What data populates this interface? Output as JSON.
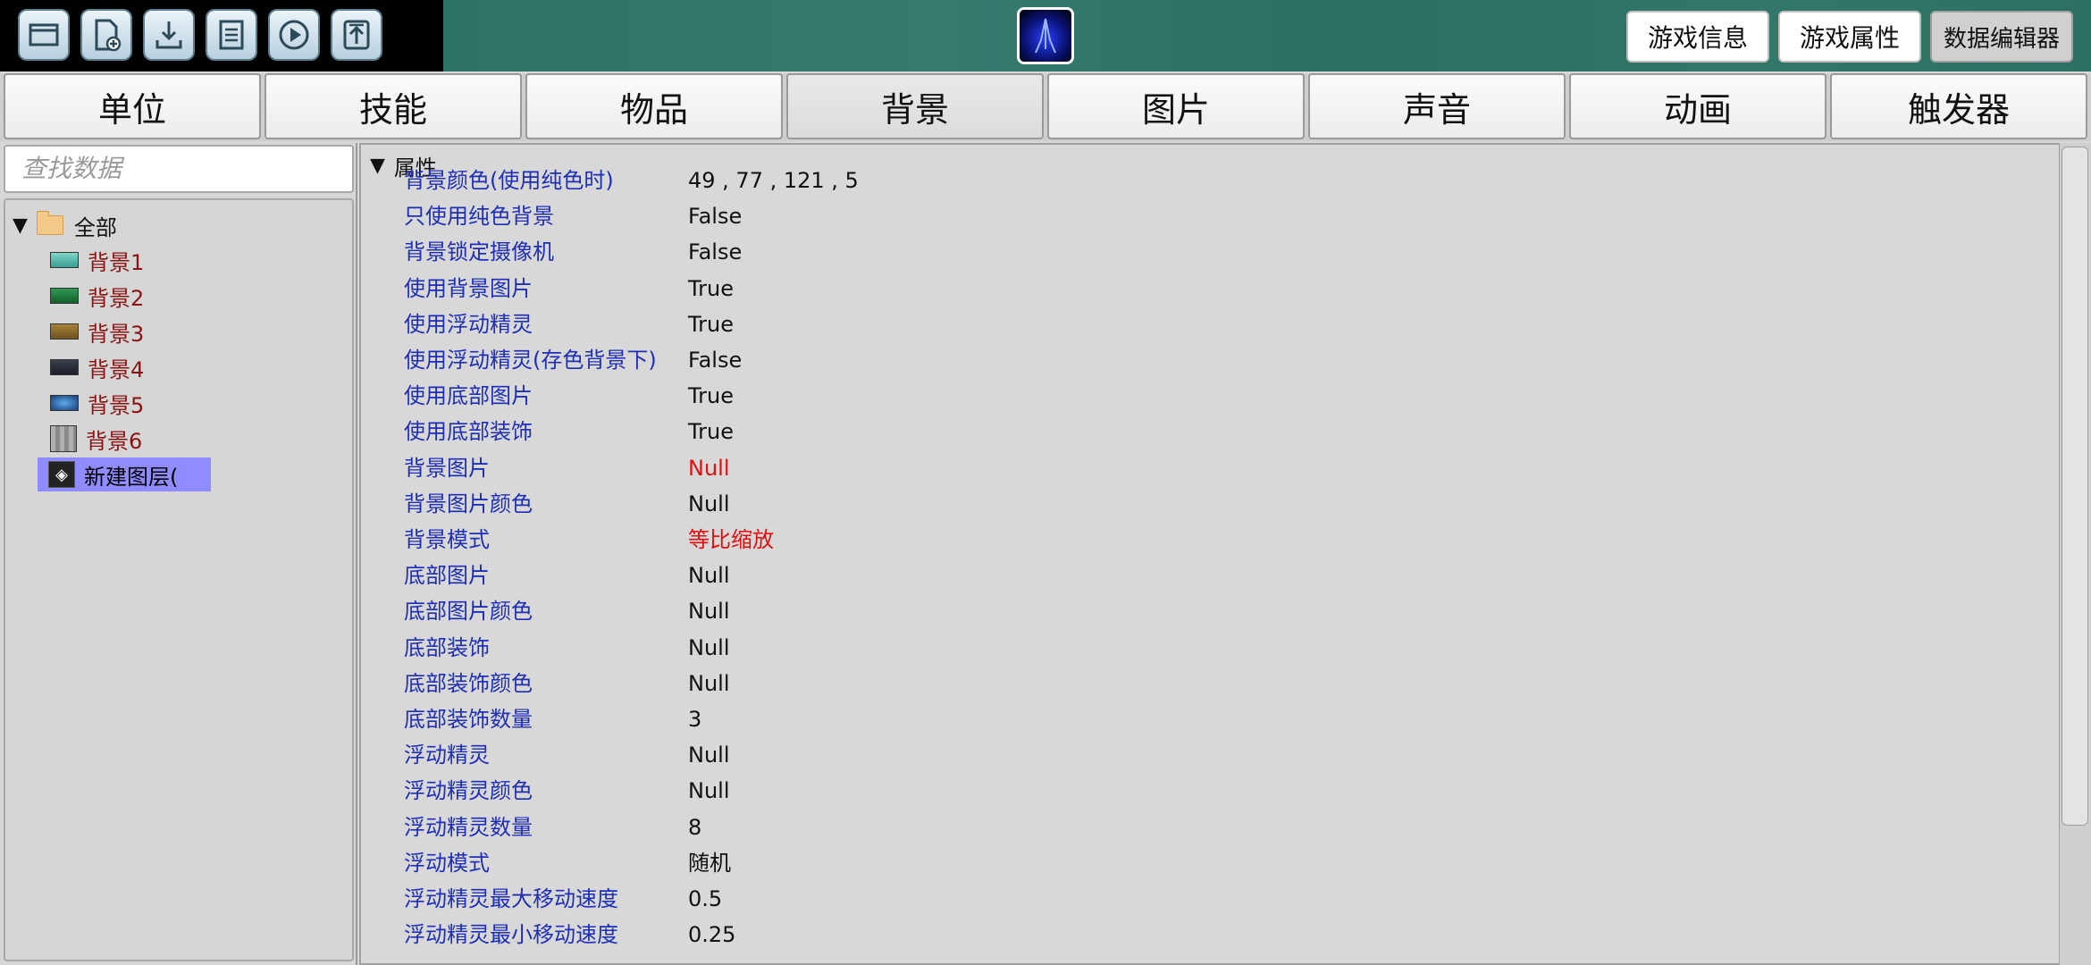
{
  "toolbar": {
    "tools": [
      {
        "icon": "open-folder-icon"
      },
      {
        "icon": "new-file-icon"
      },
      {
        "icon": "download-icon"
      },
      {
        "icon": "save-icon"
      },
      {
        "icon": "play-icon"
      },
      {
        "icon": "upload-icon"
      }
    ],
    "buttons": {
      "game_info": "游戏信息",
      "game_props": "游戏属性",
      "data_editor": "数据编辑器"
    }
  },
  "tabs": [
    "单位",
    "技能",
    "物品",
    "背景",
    "图片",
    "声音",
    "动画",
    "触发器"
  ],
  "active_tab": "背景",
  "search": {
    "placeholder": "查找数据"
  },
  "tree": {
    "root": "全部",
    "items": [
      {
        "label": "背景1",
        "thumb_color": "#4fb3a8"
      },
      {
        "label": "背景2",
        "thumb_color": "#1f7a3e"
      },
      {
        "label": "背景3",
        "thumb_color": "#8a6a2a"
      },
      {
        "label": "背景4",
        "thumb_color": "#2a2f3a"
      },
      {
        "label": "背景5",
        "thumb_color": "#2a6aa8"
      },
      {
        "label": "背景6",
        "thumb_color": "#9a9a9a"
      },
      {
        "label": "新建图层(",
        "selected": true
      }
    ]
  },
  "properties": {
    "header": "属性",
    "rows": [
      {
        "name": "背景颜色(使用纯色时)",
        "value": "49 , 77 , 121 , 5"
      },
      {
        "name": "只使用纯色背景",
        "value": "False"
      },
      {
        "name": "背景锁定摄像机",
        "value": "False"
      },
      {
        "name": "使用背景图片",
        "value": "True"
      },
      {
        "name": "使用浮动精灵",
        "value": "True"
      },
      {
        "name": "使用浮动精灵(存色背景下)",
        "value": "False"
      },
      {
        "name": "使用底部图片",
        "value": "True"
      },
      {
        "name": "使用底部装饰",
        "value": "True"
      },
      {
        "name": "背景图片",
        "value": "Null",
        "red": true
      },
      {
        "name": "背景图片颜色",
        "value": "Null"
      },
      {
        "name": "背景模式",
        "value": "等比缩放",
        "red": true
      },
      {
        "name": "底部图片",
        "value": "Null"
      },
      {
        "name": "底部图片颜色",
        "value": "Null"
      },
      {
        "name": "底部装饰",
        "value": "Null"
      },
      {
        "name": "底部装饰颜色",
        "value": "Null"
      },
      {
        "name": "底部装饰数量",
        "value": "3"
      },
      {
        "name": "浮动精灵",
        "value": "Null"
      },
      {
        "name": "浮动精灵颜色",
        "value": "Null"
      },
      {
        "name": "浮动精灵数量",
        "value": "8"
      },
      {
        "name": "浮动模式",
        "value": "随机"
      },
      {
        "name": "浮动精灵最大移动速度",
        "value": "0.5"
      },
      {
        "name": "浮动精灵最小移动速度",
        "value": "0.25"
      }
    ]
  }
}
